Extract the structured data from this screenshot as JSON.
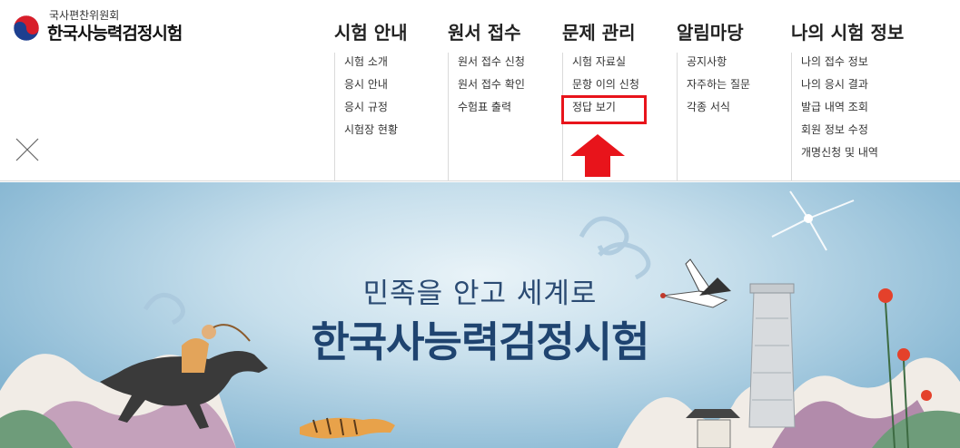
{
  "logo": {
    "org": "국사편찬위원회",
    "name": "한국사능력검정시험"
  },
  "nav": {
    "menus": [
      {
        "label": "시험 안내",
        "items": [
          "시험 소개",
          "응시 안내",
          "응시 규정",
          "시험장 현황"
        ]
      },
      {
        "label": "원서 접수",
        "items": [
          "원서 접수 신청",
          "원서 접수 확인",
          "수험표 출력"
        ]
      },
      {
        "label": "문제 관리",
        "items": [
          "시험 자료실",
          "문항 이의 신청",
          "정답 보기"
        ]
      },
      {
        "label": "알림마당",
        "items": [
          "공지사항",
          "자주하는 질문",
          "각종 서식"
        ]
      },
      {
        "label": "나의 시험 정보",
        "items": [
          "나의 접수 정보",
          "나의 응시 결과",
          "발급 내역 조회",
          "회원 정보 수정",
          "개명신청 및 내역"
        ]
      }
    ]
  },
  "banner": {
    "subtitle": "민족을 안고 세계로",
    "title": "한국사능력검정시험"
  },
  "annotation": {
    "highlight_color": "#e8141b",
    "highlighted_item": "정답 보기"
  },
  "icons": {
    "close": "close-icon",
    "arrow": "red-up-arrow-icon"
  }
}
